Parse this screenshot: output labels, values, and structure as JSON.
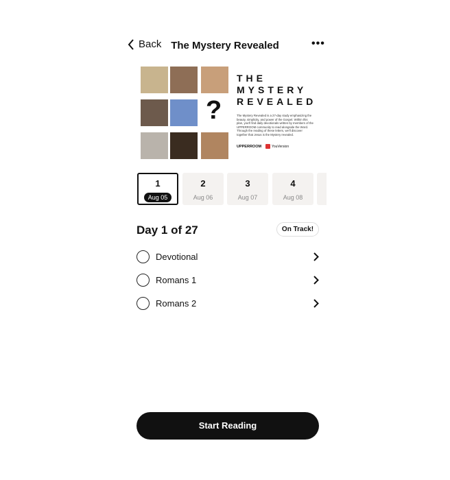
{
  "header": {
    "back_label": "Back",
    "title": "The Mystery Revealed",
    "more_icon": "ellipsis-icon"
  },
  "cover": {
    "title_lines": [
      "THE",
      "MYSTERY",
      "REVEALED"
    ],
    "description": "The Mystery Revealed is a 27-day study emphasizing the beauty, simplicity, and power of the Gospel. Within this plan, you'll find daily devotionals written by members of the UPPERROOM community to read alongside the Word. Through the reading of these letters, we'll discover together that Jesus is the Mystery revealed.",
    "logo_left": "UPPERROOM",
    "logo_right": "YouVersion",
    "question_mark": "?"
  },
  "days": [
    {
      "number": "1",
      "date": "Aug 05",
      "selected": true
    },
    {
      "number": "2",
      "date": "Aug 06"
    },
    {
      "number": "3",
      "date": "Aug 07"
    },
    {
      "number": "4",
      "date": "Aug 08"
    }
  ],
  "progress": {
    "day_label": "Day 1 of 27",
    "status": "On Track!"
  },
  "readings": [
    {
      "label": "Devotional",
      "completed": false
    },
    {
      "label": "Romans 1",
      "completed": false
    },
    {
      "label": "Romans 2",
      "completed": false
    }
  ],
  "cta": {
    "label": "Start Reading"
  }
}
